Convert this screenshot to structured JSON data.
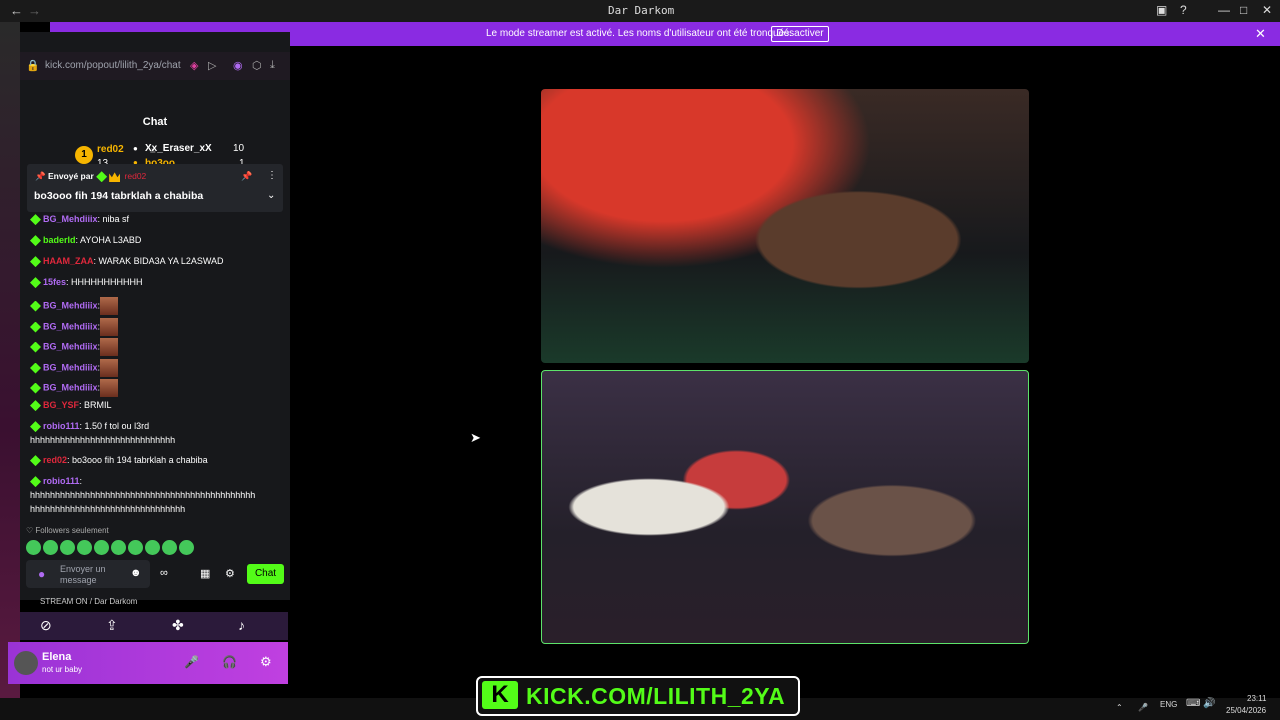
{
  "window": {
    "title": "Dar Darkom"
  },
  "banner": {
    "message": "Le mode streamer est activé. Les noms d'utilisateur ont été tronqués.",
    "button": "Désactiver"
  },
  "chat": {
    "url": "kick.com/popout/lilith_2ya/chat",
    "title": "Chat",
    "leaderboard": [
      {
        "rank": "1",
        "name": "red02",
        "count": "13"
      },
      {
        "name": "Xx_Eraser_xX",
        "count": "10"
      },
      {
        "name": "bo3oo",
        "count": "1"
      }
    ],
    "pinned": {
      "by_label": "Envoyé par",
      "by_user": "red02",
      "text": "bo3ooo fih 194 tabrklah a chabiba"
    },
    "messages": [
      {
        "user": "BG_Mehdiiix",
        "text": ": niba sf",
        "color": "#b06bf3"
      },
      {
        "user": "baderld",
        "text": ": AYOHA L3ABD",
        "color": "#53fc18"
      },
      {
        "user": "HAAM_ZAA",
        "text": ": WARAK BIDA3A YA L2ASWAD",
        "color": "#e0283c"
      },
      {
        "user": "15fes",
        "text": ": HHHHHHHHHHH",
        "color": "#b06bf3"
      },
      {
        "user": "BG_Mehdiiix",
        "text": ":",
        "color": "#b06bf3"
      },
      {
        "user": "BG_Mehdiiix",
        "text": ":",
        "color": "#b06bf3"
      },
      {
        "user": "BG_Mehdiiix",
        "text": ":",
        "color": "#b06bf3"
      },
      {
        "user": "BG_Mehdiiix",
        "text": ":",
        "color": "#b06bf3"
      },
      {
        "user": "BG_Mehdiiix",
        "text": ":",
        "color": "#b06bf3"
      },
      {
        "user": "BG_YSF",
        "text": ": BRMIL",
        "color": "#e0283c"
      },
      {
        "user": "robio111",
        "text": ": 1.50 f tol ou l3rd",
        "color": "#b06bf3"
      },
      {
        "user": "",
        "text": "hhhhhhhhhhhhhhhhhhhhhhhhhhhhh",
        "color": "#fff"
      },
      {
        "user": "red02",
        "text": ": bo3ooo fih 194 tabrklah a chabiba",
        "color": "#e0283c"
      },
      {
        "user": "robio111",
        "text": ":",
        "color": "#b06bf3"
      },
      {
        "user": "",
        "text": "hhhhhhhhhhhhhhhhhhhhhhhhhhhhhhhhhhhhhhhhhhhhh",
        "color": "#fff"
      },
      {
        "user": "",
        "text": "hhhhhhhhhhhhhhhhhhhhhhhhhhhhhhh",
        "color": "#fff"
      }
    ],
    "followers_only": "Followers seulement",
    "input_placeholder": "Envoyer un message",
    "send_button": "Chat"
  },
  "discord": {
    "stream_status": "STREAM ON / Dar Darkom",
    "user_name": "Elena",
    "user_status": "not ur baby"
  },
  "overlay": {
    "kick_text": "KICK.COM/LILITH_2YA"
  },
  "taskbar": {
    "lang": "ENG",
    "time": "23:11",
    "date": "25/04/2026"
  }
}
